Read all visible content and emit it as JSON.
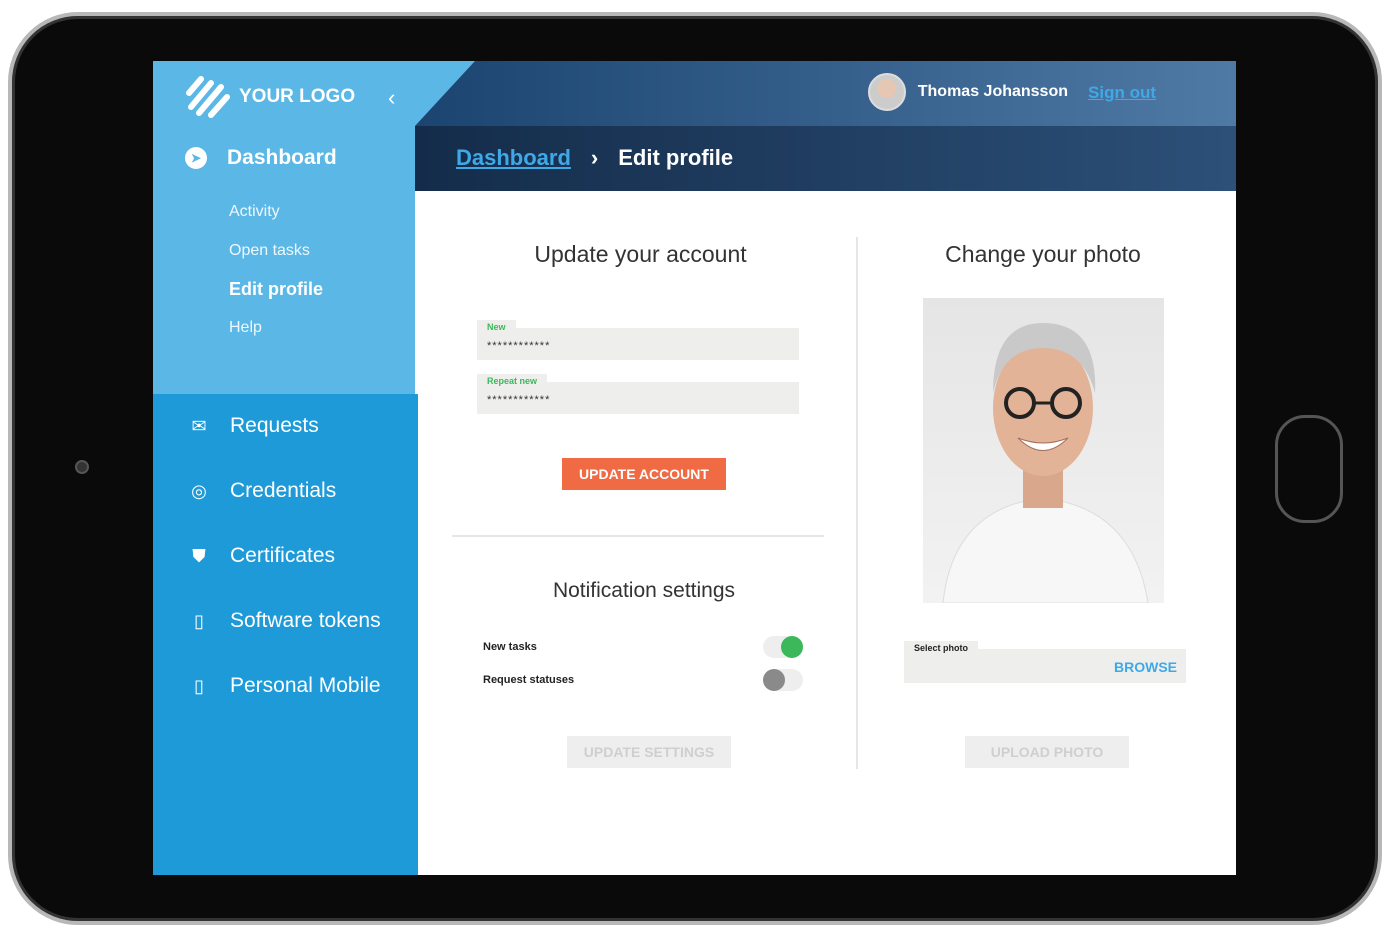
{
  "sidebar": {
    "logo": "YOUR LOGO",
    "main_item": "Dashboard",
    "sub_items": [
      {
        "label": "Activity"
      },
      {
        "label": "Open tasks"
      },
      {
        "label": "Edit profile",
        "active": true
      },
      {
        "label": "Help"
      }
    ],
    "items": [
      {
        "label": "Requests",
        "icon": "envelope-icon"
      },
      {
        "label": "Credentials",
        "icon": "fingerprint-icon"
      },
      {
        "label": "Certificates",
        "icon": "shield-check-icon"
      },
      {
        "label": "Software tokens",
        "icon": "phone-icon"
      },
      {
        "label": "Personal Mobile",
        "icon": "phone-icon"
      }
    ]
  },
  "header": {
    "user_name": "Thomas Johansson",
    "sign_out": "Sign out"
  },
  "breadcrumb": {
    "parent": "Dashboard",
    "current": "Edit profile"
  },
  "account": {
    "title": "Update your account",
    "new_label": "New",
    "new_value": "************",
    "repeat_label": "Repeat new",
    "repeat_value": "************",
    "button": "UPDATE ACCOUNT"
  },
  "notifications": {
    "title": "Notification settings",
    "toggles": [
      {
        "label": "New tasks",
        "on": true
      },
      {
        "label": "Request statuses",
        "on": false
      }
    ],
    "button": "UPDATE SETTINGS"
  },
  "photo": {
    "title": "Change your photo",
    "select_label": "Select photo",
    "browse": "BROWSE",
    "button": "UPLOAD PHOTO"
  },
  "colors": {
    "sidebar_light": "#5ab7e6",
    "sidebar": "#1e9ad8",
    "header": "#1a3a60",
    "accent": "#f06a43",
    "link": "#3fa9e8",
    "toggle_on": "#3cb85a"
  }
}
